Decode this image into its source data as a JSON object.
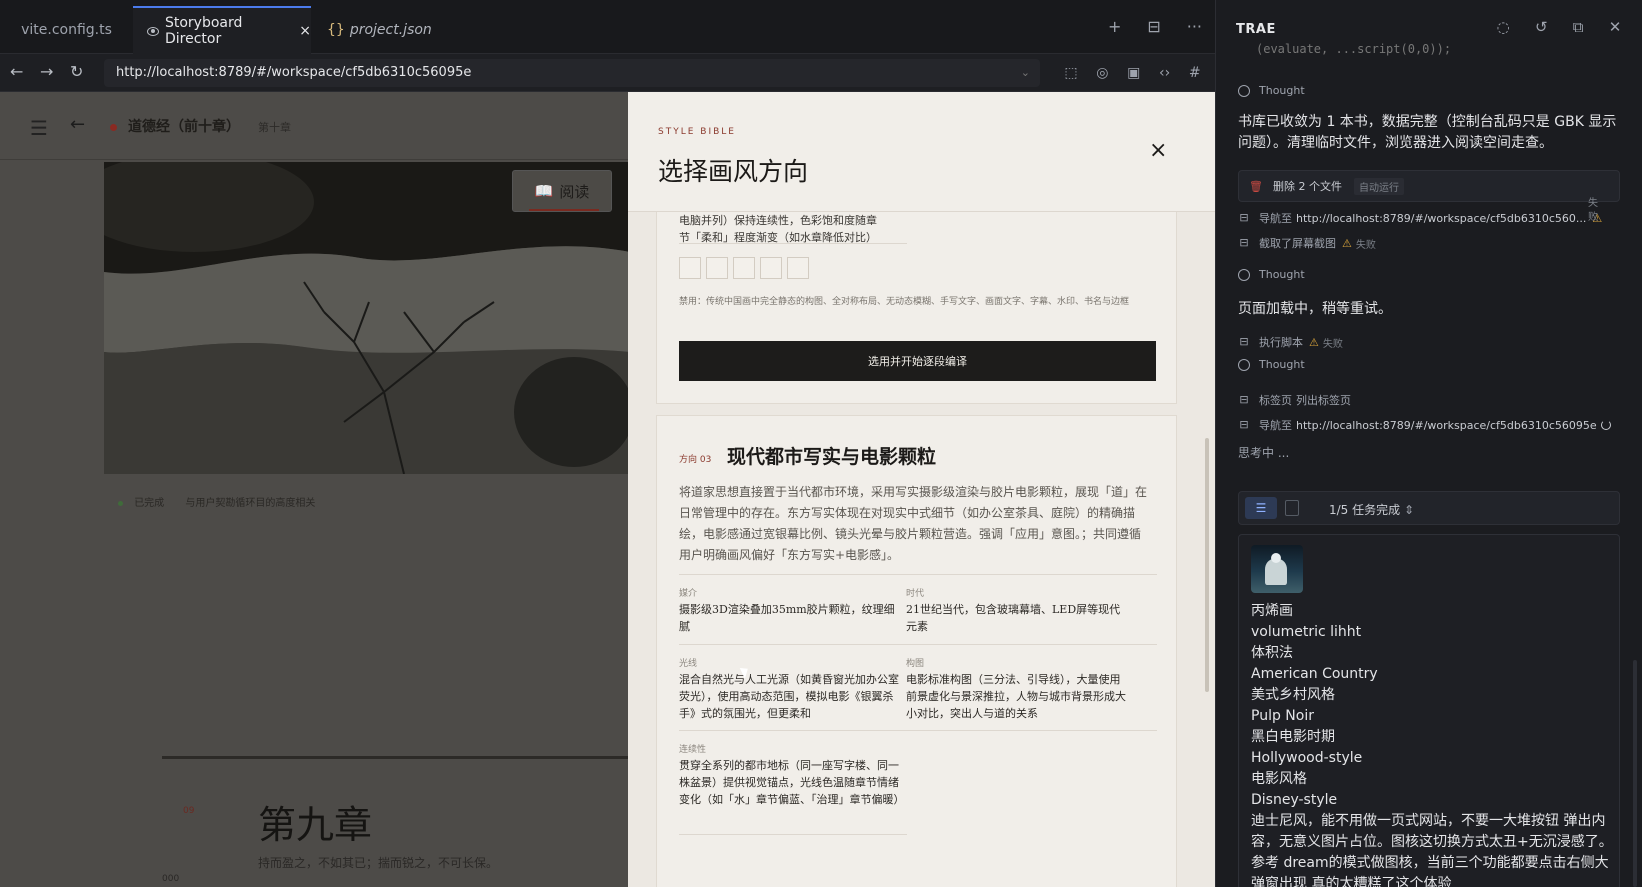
{
  "tabs": [
    {
      "label": "vite.config.ts"
    },
    {
      "label": "Storyboard Director",
      "close": "×"
    },
    {
      "label": "project.json",
      "icon": "{}"
    }
  ],
  "tab_tools": [
    "+",
    "⊟",
    "···"
  ],
  "url": "http://localhost:8789/#/workspace/cf5db6310c56095e",
  "app": {
    "book_title": "道德经（前十章）",
    "chapter_hint": "第十章",
    "read_label": "阅读",
    "caption_status": "已完成",
    "caption_text": "与用户契勘循环目的高度相关",
    "chapter_num": "09",
    "chapter_title": "第九章",
    "chapter_text": "持而盈之，不如其已；揣而锐之，不可长保。",
    "num_next": "000"
  },
  "modal": {
    "kicker": "STYLE BIBLE",
    "title": "选择画风方向",
    "close": "×",
    "card1": {
      "text_line1": "电脑并列）保持连续性，色彩饱和度随章",
      "text_line2": "节「柔和」程度渐变（如水章降低对比）",
      "ban": "禁用：传统中国画中完全静态的构图、全对称布局、无动态模糊、手写文字、画面文字、字幕、水印、书名与边框",
      "use_button": "选用并开始逐段编译"
    },
    "card2": {
      "direction": "方向 03",
      "title": "现代都市写实与电影颗粒",
      "desc": "将道家思想直接置于当代都市环境，采用写实摄影级渲染与胶片电影颗粒，展现「道」在日常管理中的存在。东方写实体现在对现实中式细节（如办公室茶具、庭院）的精确描绘，电影感通过宽银幕比例、镜头光晕与胶片颗粒营造。强调「应用」意图。；共同遵循用户明确画风偏好「东方写实+电影感」。",
      "fields": [
        {
          "label": "媒介",
          "value": "摄影级3D渲染叠加35mm胶片颗粒，纹理细腻"
        },
        {
          "label": "时代",
          "value": "21世纪当代，包含玻璃幕墙、LED屏等现代元素"
        },
        {
          "label": "光线",
          "value": "混合自然光与人工光源（如黄昏窗光加办公室荧光），使用高动态范围，模拟电影《银翼杀手》式的氛围光，但更柔和"
        },
        {
          "label": "构图",
          "value": "电影标准构图（三分法、引导线），大量使用前景虚化与景深推拉，人物与城市背景形成大小对比，突出人与道的关系"
        },
        {
          "label": "连续性",
          "value": "贯穿全系列的都市地标（同一座写字楼、同一株盆景）提供视觉锚点，光线色温随章节情绪变化（如「水」章节偏蓝、「治理」章节偏暖）"
        }
      ]
    }
  },
  "trae": {
    "name": "TRAE",
    "top_clip": "(evaluate, ...script(0,0));",
    "thought": "Thought",
    "msg1": "书库已收敛为 1 本书，数据完整（控制台乱码只是 GBK 显示问题）。清理临时文件，浏览器进入阅读空间走查。",
    "chip_label": "删除 2 个文件",
    "chip_tag": "自动运行",
    "nav1_label": "导航至",
    "nav1_url": "http://localhost:8789/#/workspace/cf5db6310c560...",
    "side_fail": "失败",
    "shot_label": "截取了屏幕截图",
    "fail": "失败",
    "msg2": "页面加载中，稍等重试。",
    "script_label": "执行脚本",
    "tabs_label": "标签页",
    "tabs_sub": "列出标签页",
    "nav2_label": "导航至",
    "nav2_url": "http://localhost:8789/#/workspace/cf5db6310c56095e",
    "thinking": "思考中 ...",
    "task_progress": "1/5 任务完成",
    "list": [
      "丙烯画",
      "volumetric lihht",
      "体积法",
      "American Country",
      "美式乡村风格",
      "Pulp Noir",
      "黑白电影时期",
      "Hollywood-style",
      "电影风格",
      "Disney-style",
      "迪士尼风，能不用做一页式网站，不要一大堆按钮 弹出内容，无意义图片占位。图核这切换方式太丑+无沉浸感了。参考 dream的模式做图核，当前三个功能都要点击右侧大弹窗出现 真的太糟糕了这个体验"
    ]
  },
  "colors": {
    "accent_red": "#8b3a2e",
    "tab_accent": "#4b7bec",
    "warn": "#d9a43b"
  }
}
